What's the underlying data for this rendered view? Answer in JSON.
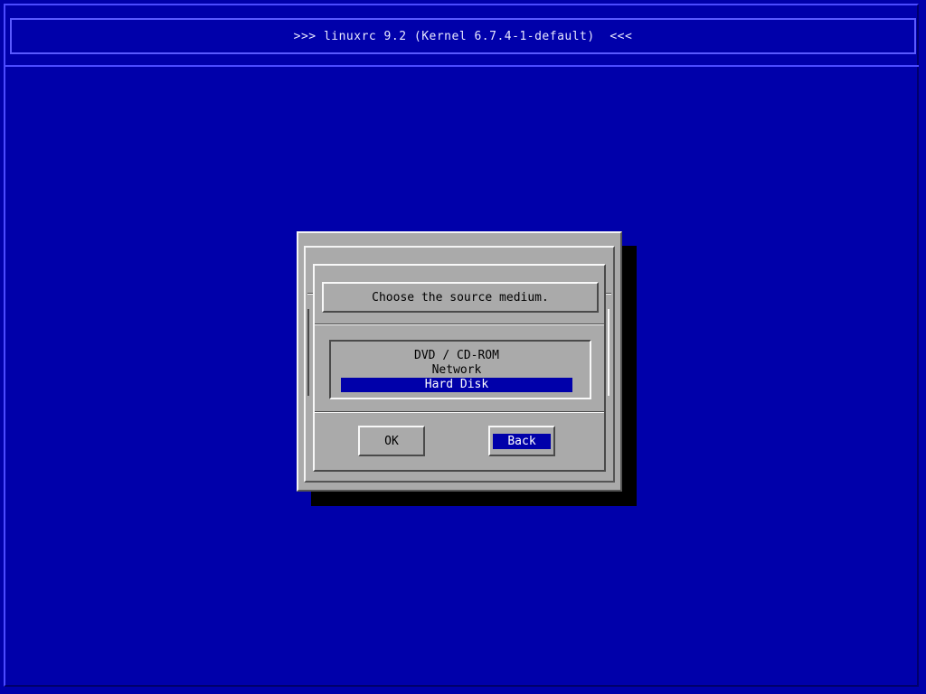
{
  "header": {
    "title": ">>> linuxrc 9.2 (Kernel 6.7.4-1-default)  <<<"
  },
  "dialog": {
    "prompt": "Choose the source medium.",
    "options": [
      "DVD / CD-ROM",
      "Network",
      "Hard Disk"
    ],
    "selected_option": "Hard Disk",
    "buttons": {
      "ok_label": "OK",
      "back_label": "Back"
    },
    "focused_button": "Back"
  },
  "colors": {
    "background": "#0000aa",
    "dialog": "#aaaaaa",
    "highlight": "#0000aa",
    "shadow": "#000000"
  }
}
